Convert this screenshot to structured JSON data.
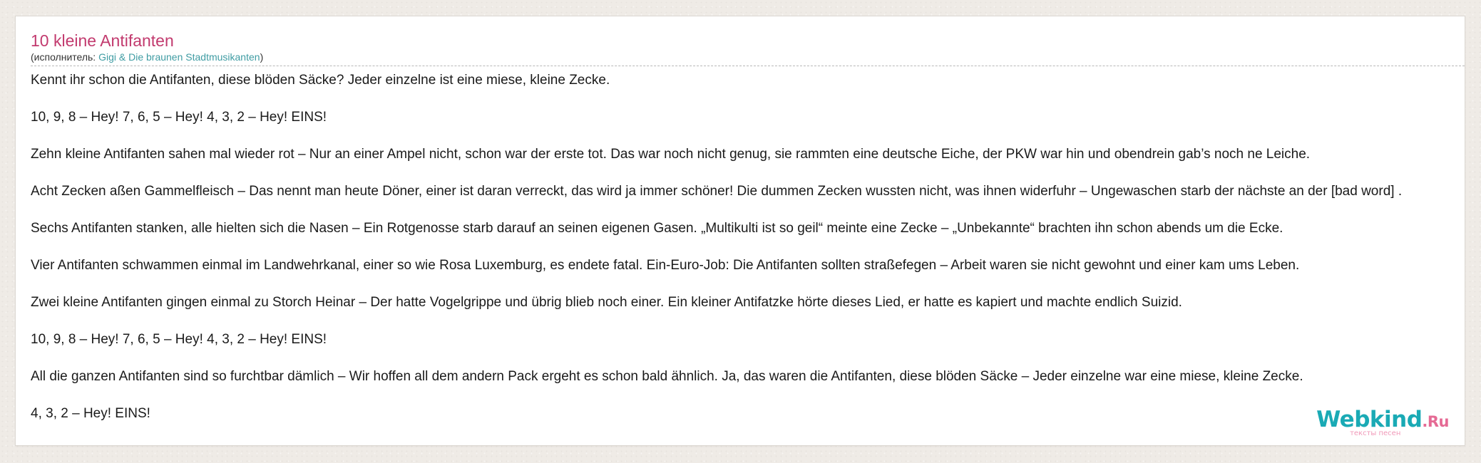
{
  "song": {
    "title": "10 kleine Antifanten",
    "performer_prefix": "(исполнитель: ",
    "performer_name": "Gigi & Die braunen Stadtmusikanten",
    "performer_suffix": ")"
  },
  "lyrics": [
    "Kennt ihr schon die Antifanten, diese blöden Säcke? Jeder einzelne ist eine miese, kleine Zecke.",
    "10, 9, 8 – Hey! 7, 6, 5 – Hey! 4, 3, 2 – Hey! EINS!",
    "Zehn kleine Antifanten sahen mal wieder rot – Nur an einer Ampel nicht, schon war der erste tot. Das war noch nicht genug, sie rammten eine deutsche Eiche, der PKW war hin und obendrein gab’s noch ne Leiche.",
    "Acht Zecken aßen Gammelfleisch – Das nennt man heute Döner, einer ist daran verreckt, das wird ja immer schöner! Die dummen Zecken wussten nicht, was ihnen widerfuhr – Ungewaschen starb der nächste an der [bad word] .",
    "Sechs Antifanten stanken, alle hielten sich die Nasen – Ein Rotgenosse starb darauf an seinen eigenen Gasen. „Multikulti ist so geil“ meinte eine Zecke – „Unbekannte“ brachten ihn schon abends um die Ecke.",
    "Vier Antifanten schwammen einmal im Landwehrkanal, einer so wie Rosa Luxemburg, es endete fatal. Ein-Euro-Job: Die Antifanten sollten straßefegen – Arbeit waren sie nicht gewohnt und einer kam ums Leben.",
    "Zwei kleine Antifanten gingen einmal zu Storch Heinar – Der hatte Vogelgrippe und übrig blieb noch einer. Ein kleiner Antifatzke hörte dieses Lied, er hatte es kapiert und machte endlich Suizid.",
    "10, 9, 8 – Hey! 7, 6, 5 – Hey! 4, 3, 2 – Hey! EINS!",
    "All die ganzen Antifanten sind so furchtbar dämlich – Wir hoffen all dem andern Pack ergeht es schon bald ähnlich. Ja, das waren die Antifanten, diese blöden Säcke – Jeder einzelne war eine miese, kleine Zecke.",
    "4, 3, 2 – Hey! EINS!"
  ],
  "logo": {
    "main": "Webkind",
    "suffix": ".Ru",
    "subtitle": "тексты песен"
  },
  "colors": {
    "title": "#c23a6e",
    "link": "#3f9ca3",
    "logo_main": "#1aaab5",
    "logo_accent": "#e56a94"
  }
}
